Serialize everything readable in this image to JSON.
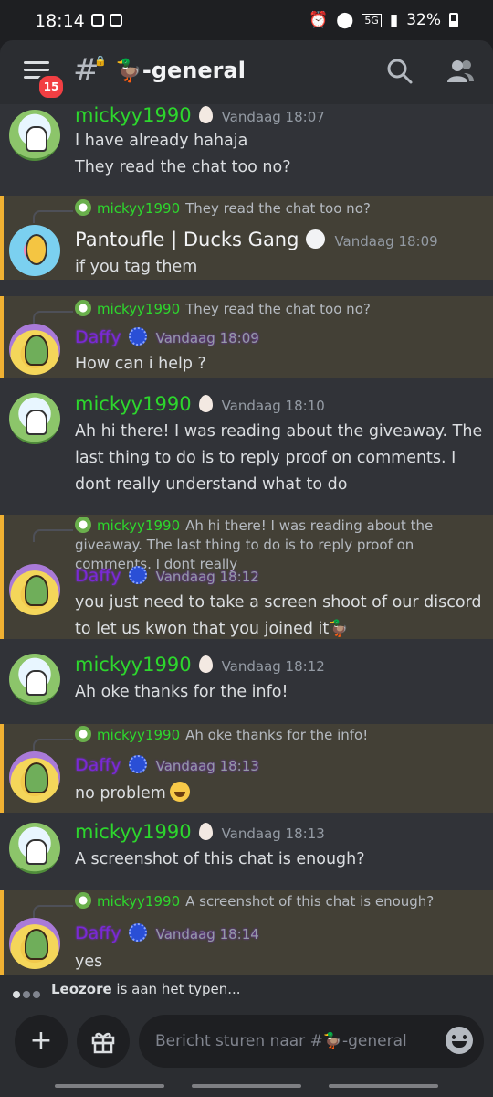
{
  "status_bar": {
    "time": "18:14",
    "network": "5G",
    "battery": "32%"
  },
  "header": {
    "badge_count": "15",
    "channel_name": "🦆-general"
  },
  "messages": [
    {
      "author": "mickyy1990",
      "time": "Vandaag 18:07",
      "lines": [
        "I have already hahaja",
        "They read the chat too no?"
      ]
    },
    {
      "reply_author": "mickyy1990",
      "reply_text": "They read the chat too no?",
      "author": "Pantoufle | Ducks Gang",
      "time": "Vandaag 18:09",
      "lines": [
        "if you tag them"
      ]
    },
    {
      "reply_author": "mickyy1990",
      "reply_text": "They read the chat too no?",
      "author": "Daffy",
      "time": "Vandaag 18:09",
      "lines": [
        "How can i help ?"
      ]
    },
    {
      "author": "mickyy1990",
      "time": "Vandaag 18:10",
      "lines": [
        "Ah hi there! I was reading about the giveaway. The last thing to do is to reply proof on comments. I dont really understand what to do"
      ]
    },
    {
      "reply_author": "mickyy1990",
      "reply_text": "Ah hi there! I was reading about the giveaway. The last thing to do is to reply proof on comments. I dont really",
      "author": "Daffy",
      "time": "Vandaag 18:12",
      "lines": [
        "you just need to take a screen shoot of our discord to let us kwon that you joined it🦆"
      ]
    },
    {
      "author": "mickyy1990",
      "time": "Vandaag 18:12",
      "lines": [
        "Ah oke thanks for the info!"
      ]
    },
    {
      "reply_author": "mickyy1990",
      "reply_text": "Ah oke thanks for the info!",
      "author": "Daffy",
      "time": "Vandaag 18:13",
      "lines": [
        "no problem"
      ]
    },
    {
      "author": "mickyy1990",
      "time": "Vandaag 18:13",
      "lines": [
        "A screenshot of this chat is enough?"
      ]
    },
    {
      "reply_author": "mickyy1990",
      "reply_text": "A screenshot of this chat is enough?",
      "author": "Daffy",
      "time": "Vandaag 18:14",
      "lines": [
        "yes"
      ]
    }
  ],
  "typing": {
    "user": "Leozore",
    "suffix": " is aan het typen..."
  },
  "composer": {
    "placeholder": "Bericht sturen naar #🦆-general"
  },
  "colors": {
    "mention_highlight": "#434036",
    "mention_bar": "#f0b132",
    "mickyy_name": "#2dd72d",
    "daffy_name": "#7a29d6"
  }
}
